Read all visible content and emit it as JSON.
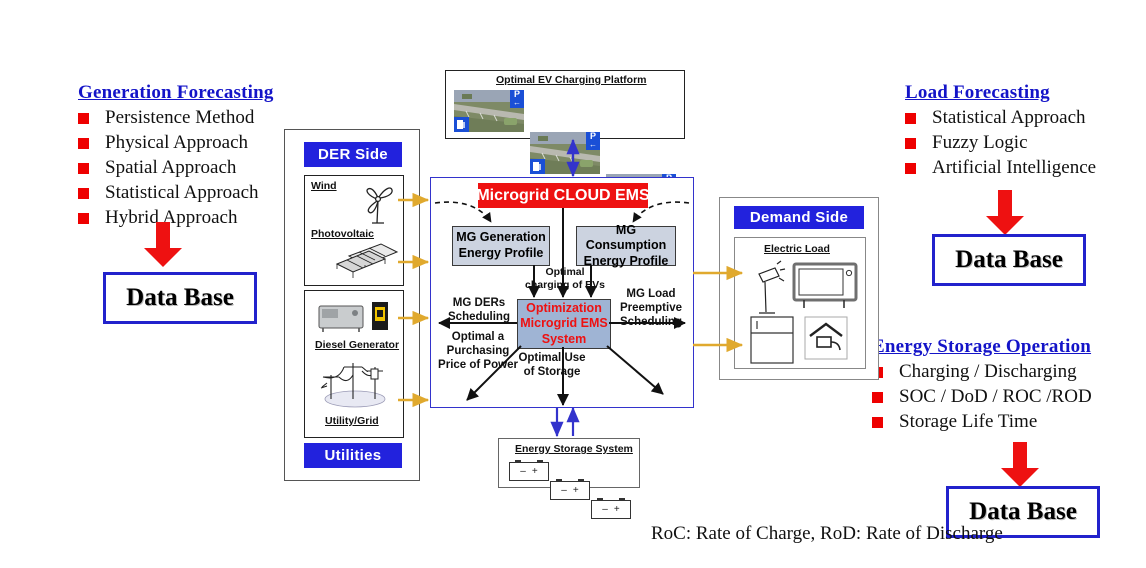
{
  "generation_forecasting": {
    "title": "Generation Forecasting",
    "items": [
      "Persistence Method",
      "Physical Approach",
      "Spatial Approach",
      "Statistical Approach",
      "Hybrid Approach"
    ],
    "database_label": "Data Base"
  },
  "load_forecasting": {
    "title": "Load Forecasting",
    "items": [
      "Statistical Approach",
      "Fuzzy Logic",
      "Artificial Intelligence"
    ],
    "database_label": "Data Base"
  },
  "energy_storage_operation": {
    "title": "Energy Storage Operation",
    "items": [
      "Charging / Discharging",
      "SOC / DoD / ROC /ROD",
      "Storage Life Time"
    ],
    "database_label": "Data Base"
  },
  "der_side": {
    "header": "DER Side",
    "footer": "Utilities",
    "renewables": [
      "Wind",
      "Photovoltaic"
    ],
    "conventional": [
      "Diesel Generator",
      "Utility/Grid"
    ]
  },
  "demand_side": {
    "header": "Demand Side",
    "panel_title": "Electric Load"
  },
  "ev_platform": {
    "title": "Optimal EV Charging Platform",
    "sign_label": "P",
    "thumbnail_count": 3
  },
  "ems": {
    "banner": "Microgrid CLOUD EMS",
    "generation_profile": [
      "MG Generation",
      "Energy Profile"
    ],
    "consumption_profile": [
      "MG Consumption",
      "Energy Profile"
    ],
    "optimization": [
      "Optimization",
      "Microgrid EMS",
      "System"
    ],
    "labels": {
      "ev_charging": [
        "Optimal",
        "charging of EVs"
      ],
      "der_scheduling": [
        "MG DERs",
        "Scheduling"
      ],
      "load_scheduling": [
        "MG Load",
        "Preemptive",
        "Scheduling"
      ],
      "purchasing_price": [
        "Optimal a",
        "Purchasing",
        "Price of Power"
      ],
      "storage_use": [
        "Optimal Use",
        "of Storage"
      ]
    }
  },
  "energy_storage": {
    "title": "Energy Storage System",
    "battery_minus": "–",
    "battery_plus": "+",
    "battery_count": 3
  },
  "footnote": "RoC: Rate of Charge, RoD: Rate of Discharge",
  "colors": {
    "accent_blue": "#2222dd",
    "title_blue": "#1414c8",
    "red": "#ee1111",
    "bullet_red": "#ee0000",
    "gold": "#e0a92e"
  }
}
